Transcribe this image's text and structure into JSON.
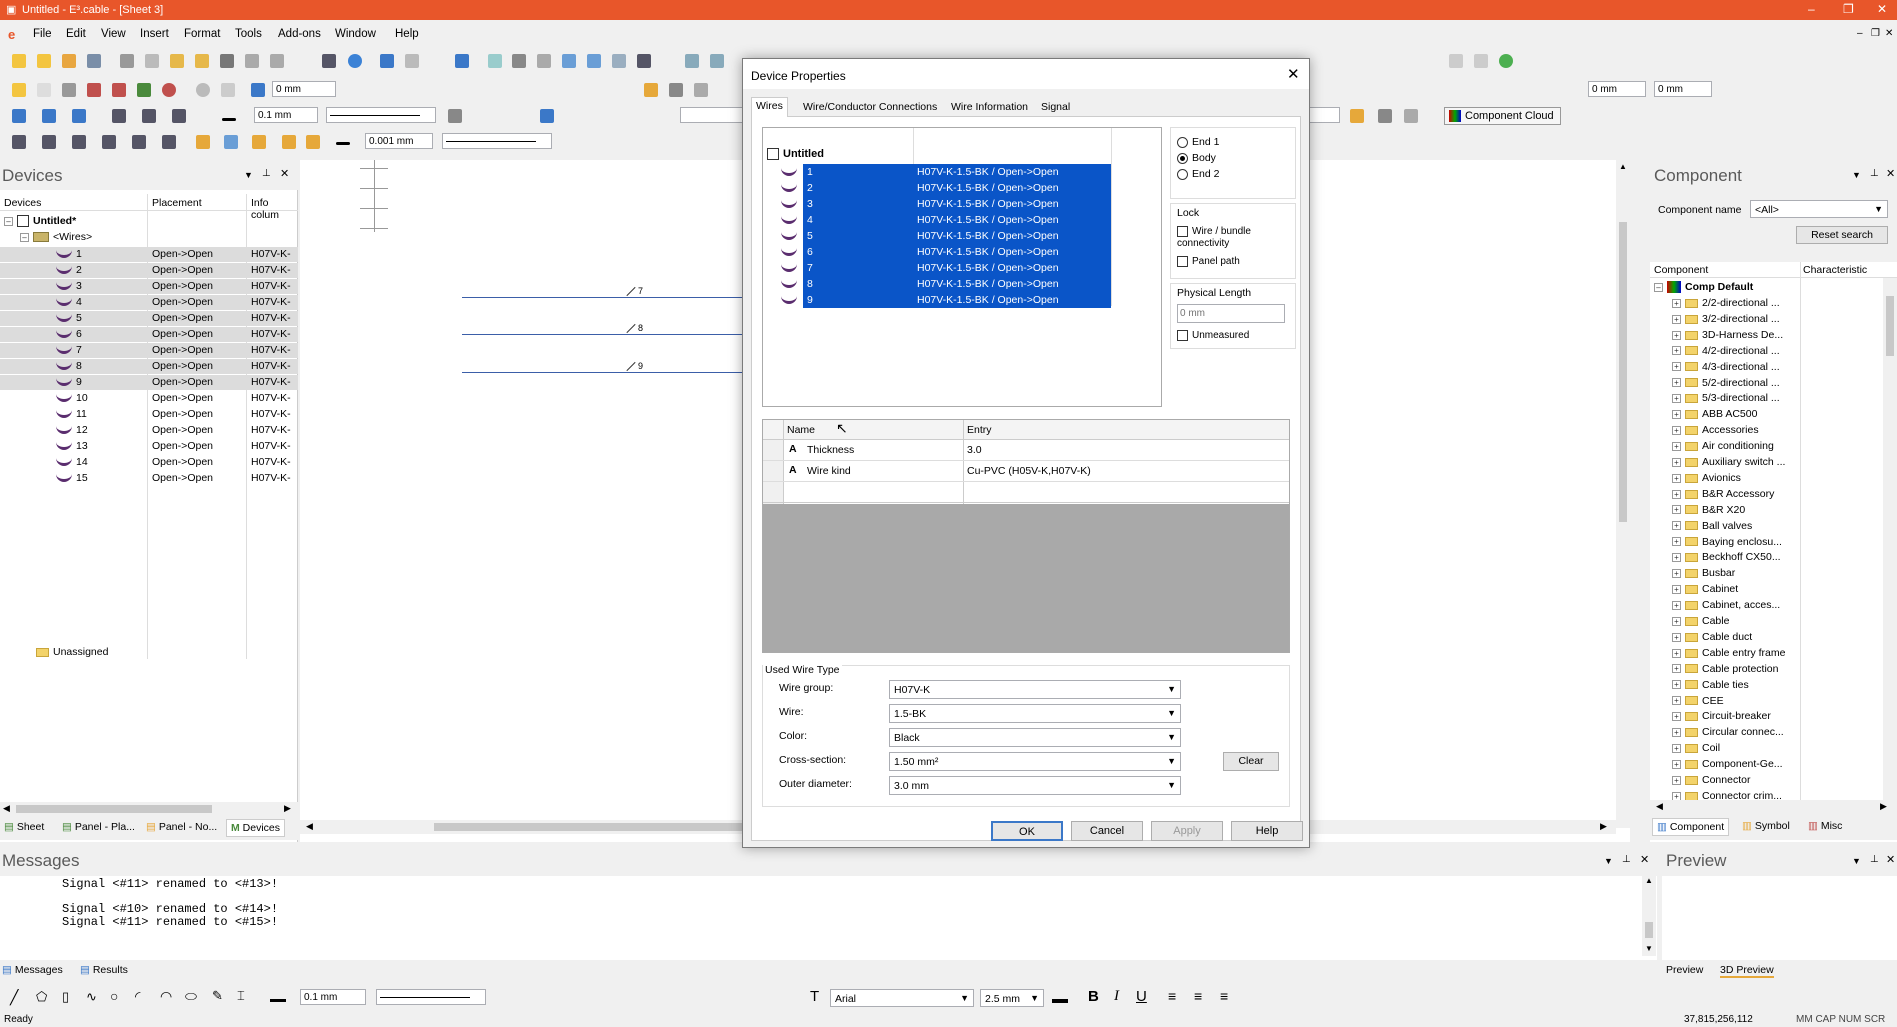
{
  "app": {
    "title": "Untitled - E³.cable - [Sheet 3]",
    "menu": [
      "File",
      "Edit",
      "View",
      "Insert",
      "Format",
      "Tools",
      "Add-ons",
      "Window",
      "Help"
    ]
  },
  "toolbar": {
    "offset1": "0 mm",
    "line_width": "0.1 mm",
    "grid": "0.001 mm",
    "offset_x": "0 mm",
    "offset_y": "0 mm",
    "component_cloud": "Component Cloud"
  },
  "devices": {
    "title": "Devices",
    "columns": [
      "Devices",
      "Placement",
      "Info colum"
    ],
    "root": "Untitled*",
    "group": "<Wires>",
    "items": [
      {
        "n": "1",
        "placement": "Open->Open",
        "info": "H07V-K-"
      },
      {
        "n": "2",
        "placement": "Open->Open",
        "info": "H07V-K-"
      },
      {
        "n": "3",
        "placement": "Open->Open",
        "info": "H07V-K-"
      },
      {
        "n": "4",
        "placement": "Open->Open",
        "info": "H07V-K-"
      },
      {
        "n": "5",
        "placement": "Open->Open",
        "info": "H07V-K-"
      },
      {
        "n": "6",
        "placement": "Open->Open",
        "info": "H07V-K-"
      },
      {
        "n": "7",
        "placement": "Open->Open",
        "info": "H07V-K-"
      },
      {
        "n": "8",
        "placement": "Open->Open",
        "info": "H07V-K-"
      },
      {
        "n": "9",
        "placement": "Open->Open",
        "info": "H07V-K-"
      },
      {
        "n": "10",
        "placement": "Open->Open",
        "info": "H07V-K-"
      },
      {
        "n": "11",
        "placement": "Open->Open",
        "info": "H07V-K-"
      },
      {
        "n": "12",
        "placement": "Open->Open",
        "info": "H07V-K-"
      },
      {
        "n": "13",
        "placement": "Open->Open",
        "info": "H07V-K-"
      },
      {
        "n": "14",
        "placement": "Open->Open",
        "info": "H07V-K-"
      },
      {
        "n": "15",
        "placement": "Open->Open",
        "info": "H07V-K-"
      }
    ],
    "unassigned": "Unassigned",
    "tabs": [
      "Sheet",
      "Panel - Pla...",
      "Panel - No...",
      "Devices"
    ]
  },
  "canvas": {
    "wire_labels": [
      "7",
      "8",
      "9"
    ]
  },
  "dialog": {
    "title": "Device Properties",
    "tabs": [
      "Wires",
      "Wire/Conductor Connections",
      "Wire Information",
      "Signal"
    ],
    "tree_root": "Untitled",
    "wires": [
      {
        "n": "1",
        "desc": "H07V-K-1.5-BK  /  Open->Open"
      },
      {
        "n": "2",
        "desc": "H07V-K-1.5-BK  /  Open->Open"
      },
      {
        "n": "3",
        "desc": "H07V-K-1.5-BK  /  Open->Open"
      },
      {
        "n": "4",
        "desc": "H07V-K-1.5-BK  /  Open->Open"
      },
      {
        "n": "5",
        "desc": "H07V-K-1.5-BK  /  Open->Open"
      },
      {
        "n": "6",
        "desc": "H07V-K-1.5-BK  /  Open->Open"
      },
      {
        "n": "7",
        "desc": "H07V-K-1.5-BK  /  Open->Open"
      },
      {
        "n": "8",
        "desc": "H07V-K-1.5-BK  /  Open->Open"
      },
      {
        "n": "9",
        "desc": "H07V-K-1.5-BK  /  Open->Open"
      }
    ],
    "end1": "End 1",
    "body": "Body",
    "end2": "End 2",
    "lock_title": "Lock",
    "lock_wire": "Wire / bundle connectivity",
    "lock_panel": "Panel path",
    "physical_length_title": "Physical Length",
    "physical_length_placeholder": "0 mm",
    "unmeasured": "Unmeasured",
    "attr_headers": [
      "Name",
      "Entry"
    ],
    "attrs": [
      {
        "name": "Thickness",
        "entry": "3.0"
      },
      {
        "name": "Wire kind",
        "entry": "Cu-PVC (H05V-K,H07V-K)"
      }
    ],
    "used_wire_type": "Used Wire Type",
    "wire_group_label": "Wire group:",
    "wire_group": "H07V-K",
    "wire_label": "Wire:",
    "wire": "1.5-BK",
    "color_label": "Color:",
    "color": "Black",
    "cross_label": "Cross-section:",
    "cross": "1.50 mm²",
    "outer_label": "Outer diameter:",
    "outer": "3.0 mm",
    "clear": "Clear",
    "ok": "OK",
    "cancel": "Cancel",
    "apply": "Apply",
    "help": "Help"
  },
  "component": {
    "title": "Component",
    "name_label": "Component name",
    "name_value": "<All>",
    "reset": "Reset search",
    "columns": [
      "Component",
      "Characteristic"
    ],
    "root": "Comp Default",
    "items": [
      "2/2-directional ...",
      "3/2-directional ...",
      "3D-Harness De...",
      "4/2-directional ...",
      "4/3-directional ...",
      "5/2-directional ...",
      "5/3-directional ...",
      "ABB AC500",
      "Accessories",
      "Air conditioning",
      "Auxiliary switch ...",
      "Avionics",
      "B&R Accessory",
      "B&R X20",
      "Ball valves",
      "Baying enclosu...",
      "Beckhoff CX50...",
      "Busbar",
      "Cabinet",
      "Cabinet, acces...",
      "Cable",
      "Cable duct",
      "Cable entry frame",
      "Cable protection",
      "Cable ties",
      "CEE",
      "Circuit-breaker",
      "Circular connec...",
      "Coil",
      "Component-Ge...",
      "Connector",
      "Connector crim..."
    ],
    "tabs": [
      "Component",
      "Symbol",
      "Misc"
    ]
  },
  "messages": {
    "title": "Messages",
    "lines": [
      "Signal <#11> renamed to <#13>!",
      "Signal <#10> renamed to <#14>!",
      "Signal <#11> renamed to <#15>!"
    ],
    "tabs": [
      "Messages",
      "Results"
    ]
  },
  "preview": {
    "title": "Preview",
    "tabs": [
      "Preview",
      "3D Preview"
    ]
  },
  "format_bar": {
    "font": "Arial",
    "size": "2.5 mm",
    "line": "0.1 mm"
  },
  "status": {
    "left": "Ready",
    "coords": "37,815,256,112",
    "flags": "MM  CAP  NUM  SCR"
  },
  "colors": {
    "accent": "#e8562a",
    "selection": "#0a55c8",
    "wire": "#5a2d6e"
  }
}
